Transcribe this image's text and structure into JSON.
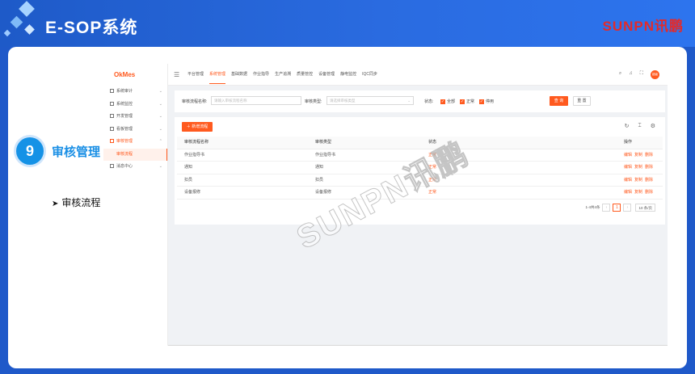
{
  "banner": {
    "title": "E-SOP系统",
    "brand": "SUNPN讯鹏"
  },
  "section": {
    "number": "9",
    "title": "审核管理",
    "subitem": "审核流程"
  },
  "app": {
    "logo": "OkMes",
    "sidebar": [
      {
        "label": "系统审计",
        "icon": "audit-icon"
      },
      {
        "label": "系统监控",
        "icon": "monitor-icon"
      },
      {
        "label": "开发管理",
        "icon": "code-icon"
      },
      {
        "label": "看板管理",
        "icon": "board-icon"
      },
      {
        "label": "审核管理",
        "icon": "review-icon",
        "active": true
      },
      {
        "label": "审核流程",
        "sub": true,
        "active": true
      },
      {
        "label": "消息中心",
        "icon": "message-icon"
      }
    ],
    "tabs": [
      "平台管理",
      "系统管理",
      "基础数据",
      "作业指导",
      "生产追溯",
      "质量管控",
      "设备管理",
      "静电监控",
      "IQC同步"
    ],
    "active_tab": "系统管理",
    "avatar": "超级",
    "filter": {
      "name_label": "审核流程名称:",
      "name_placeholder": "请输入审核流程名称",
      "type_label": "审核类型:",
      "type_placeholder": "请选择审核类型",
      "status_label": "状态:",
      "checkboxes": [
        "全部",
        "正常",
        "停用"
      ],
      "search_btn": "查 询",
      "reset_btn": "重 置"
    },
    "table": {
      "add_btn": "新增流程",
      "columns": [
        "审核流程名称",
        "审核类型",
        "状态",
        "操作"
      ],
      "rows": [
        {
          "name": "作业指导书",
          "type": "作业指导书",
          "status": "正常"
        },
        {
          "name": "通知",
          "type": "通知",
          "status": "正常"
        },
        {
          "name": "扣员",
          "type": "扣员",
          "status": "正常"
        },
        {
          "name": "设备报修",
          "type": "设备报修",
          "status": "正常"
        }
      ],
      "actions": [
        "编辑",
        "复制",
        "删除"
      ],
      "pager": {
        "summary": "1-4共4条",
        "prev": "‹",
        "current": "1",
        "next": "›",
        "size": "10 条/页"
      }
    }
  },
  "watermark": "SUNPN讯鹏",
  "colors": {
    "accent": "#ff5a1f",
    "banner": "#1f59c9",
    "section": "#1592e6"
  }
}
